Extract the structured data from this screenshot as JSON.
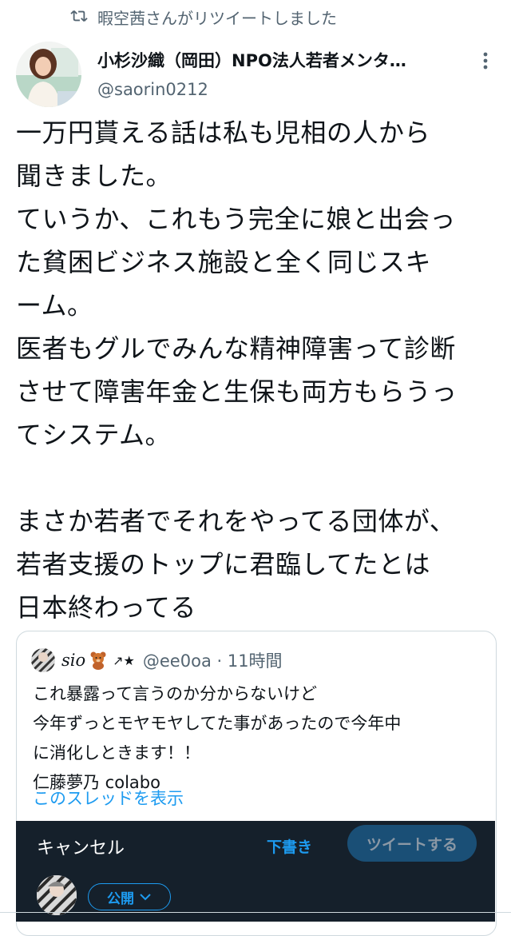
{
  "retweet_context": {
    "text": "暇空茜さんがリツイートしました",
    "icon": "retweet-icon"
  },
  "tweet": {
    "author_name": "小杉沙織（岡田）NPO法人若者メンタ…",
    "author_handle": "@saorin0212",
    "body": "一万円貰える話は私も児相の人から\n聞きました。\nていうか、これもう完全に娘と出会っ\nた貧困ビジネス施設と全く同じスキ\nーム。\n医者もグルでみんな精神障害って診断\nさせて障害年金と生保も両方もらうっ\nてシステム。\n\nまさか若者でそれをやってる団体が、\n若者支援のトップに君臨してたとは\n日本終わってる"
  },
  "quote": {
    "name": "sio",
    "emoji_star": "↗★",
    "handle_time": "@ee0oa · 11時間",
    "body": "これ暴露って言うのか分からないけど\n今年ずっとモヤモヤしてた事があったので今年中\nに消化しときます！！\n仁藤夢乃 colabo",
    "show_thread": "このスレッドを表示"
  },
  "composer": {
    "cancel_label": "キャンセル",
    "drafts_label": "下書き",
    "tweet_button_label": "ツイートする",
    "audience_label": "公開"
  },
  "colors": {
    "accent": "#1d9bf0",
    "secondary_text": "#536471",
    "composer_bg": "#15202b"
  }
}
